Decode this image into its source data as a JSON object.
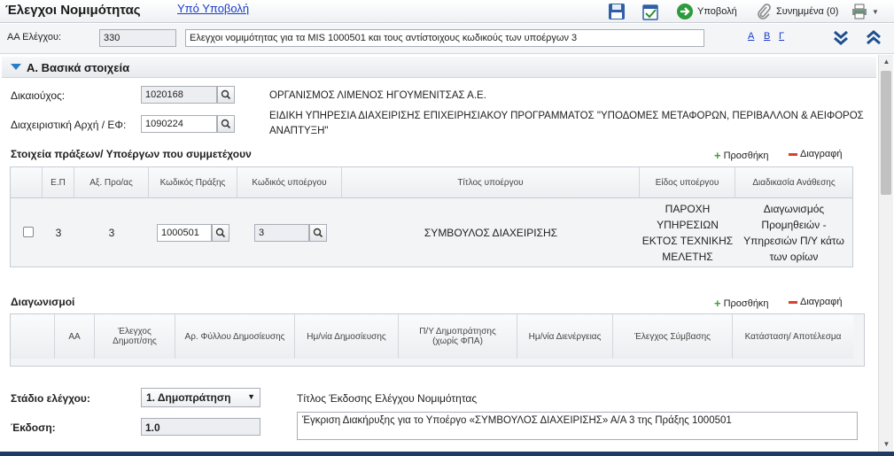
{
  "header": {
    "title": "Έλεγχοι Νομιμότητας",
    "status_link": "Υπό Υποβολή",
    "submit_label": "Υποβολή",
    "attachments_label": "Συνημμένα (0)"
  },
  "idbar": {
    "label": "ΑΑ Ελέγχου:",
    "id_value": "330",
    "description": "Ελεγχοι νομιμότητας για τα MIS 1000501 και τους αντίστοιχους κωδικούς των υποέργων 3",
    "links": [
      "A",
      "B",
      "Γ"
    ]
  },
  "section_a": {
    "title": "Α. Βασικά στοιχεία",
    "beneficiary_label": "Δικαιούχος:",
    "beneficiary_code": "1020168",
    "beneficiary_name": "ΟΡΓΑΝΙΣΜΟΣ ΛΙΜΕΝΟΣ ΗΓΟΥΜΕΝΙΤΣΑΣ Α.Ε.",
    "authority_label": "Διαχειριστική Αρχή / ΕΦ:",
    "authority_code": "1090224",
    "authority_name_line1": "ΕΙΔΙΚΗ ΥΠΗΡΕΣΙΑ ΔΙΑΧΕΙΡΙΣΗΣ ΕΠΙΧΕΙΡΗΣΙΑΚΟΥ ΠΡΟΓΡΑΜΜΑΤΟΣ \"ΥΠΟΔΟΜΕΣ ΜΕΤΑΦΟΡΩΝ, ΠΕΡΙΒΑΛΛΟΝ & ΑΕΙΦΟΡΟΣ",
    "authority_name_line2": "ΑΝΑΠΤΥΞΗ\""
  },
  "projects": {
    "title": "Στοιχεία πράξεων/ Υποέργων που συμμετέχουν",
    "add_label": "Προσθήκη",
    "delete_label": "Διαγραφή",
    "columns": [
      "Ε.Π",
      "Αξ. Προ/ας",
      "Κωδικός Πράξης",
      "Κωδικός υποέργου",
      "Τίτλος υποέργου",
      "Είδος υποέργου",
      "Διαδικασία Ανάθεσης"
    ],
    "row": {
      "ep": "3",
      "priority": "3",
      "action_code": "1000501",
      "subproject_code": "3",
      "subproject_title": "ΣΥΜΒΟΥΛΟΣ ΔΙΑΧΕΙΡΙΣΗΣ",
      "type_lines": [
        "ΠΑΡΟΧΗ",
        "ΥΠΗΡΕΣΙΩΝ",
        "ΕΚΤΟΣ ΤΕΧΝΙΚΗΣ",
        "ΜΕΛΕΤΗΣ"
      ],
      "procedure_lines": [
        "Διαγωνισμός",
        "Προμηθειών -",
        "Υπηρεσιών Π/Υ κάτω",
        "των ορίων"
      ]
    }
  },
  "tenders": {
    "title": "Διαγωνισμοί",
    "add_label": "Προσθήκη",
    "delete_label": "Διαγραφή",
    "columns": [
      [
        "ΑΑ"
      ],
      [
        "Έλεγχος",
        "Δημοπ/σης"
      ],
      [
        "Αρ. Φύλλου Δημοσίευσης"
      ],
      [
        "Ημ/νία Δημοσίευσης"
      ],
      [
        "Π/Υ Δημοπράτησης",
        "(χωρίς ΦΠΑ)"
      ],
      [
        "Ημ/νία Διενέργειας"
      ],
      [
        "Έλεγχος Σύμβασης"
      ],
      [
        "Κατάσταση/ Αποτέλεσμα"
      ]
    ]
  },
  "stage": {
    "label": "Στάδιο ελέγχου:",
    "value": "1. Δημοπράτηση",
    "issue_title_label": "Τίτλος Έκδοσης Ελέγχου Νομιμότητας",
    "issue_label": "Έκδοση:",
    "issue_value": "1.0",
    "issue_title_value": "Έγκριση Διακήρυξης για το Υποέργο «ΣΥΜΒΟΥΛΟΣ ΔΙΑΧΕΙΡΙΣΗΣ» Α/Α 3 της Πράξης 1000501"
  }
}
